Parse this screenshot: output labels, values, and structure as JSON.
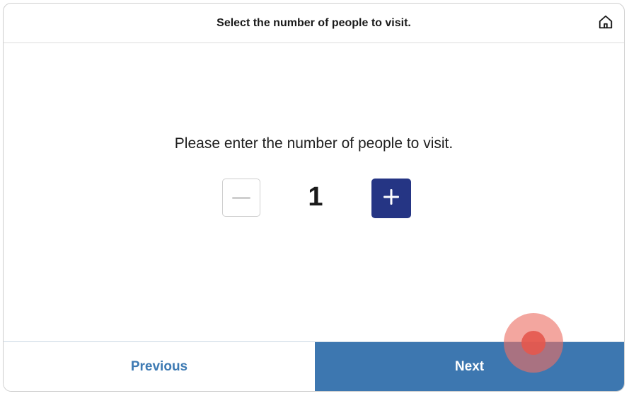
{
  "header": {
    "title": "Select the number of people to visit.",
    "home_icon": "home-icon"
  },
  "main": {
    "prompt": "Please enter the number of people to visit.",
    "stepper": {
      "value": "1",
      "decrement_icon": "minus-icon",
      "increment_icon": "plus-icon",
      "decrement_enabled": false,
      "increment_color": "#253584"
    }
  },
  "footer": {
    "previous_label": "Previous",
    "next_label": "Next",
    "previous_color": "#3d7ab3",
    "next_background": "#3d77b0"
  }
}
